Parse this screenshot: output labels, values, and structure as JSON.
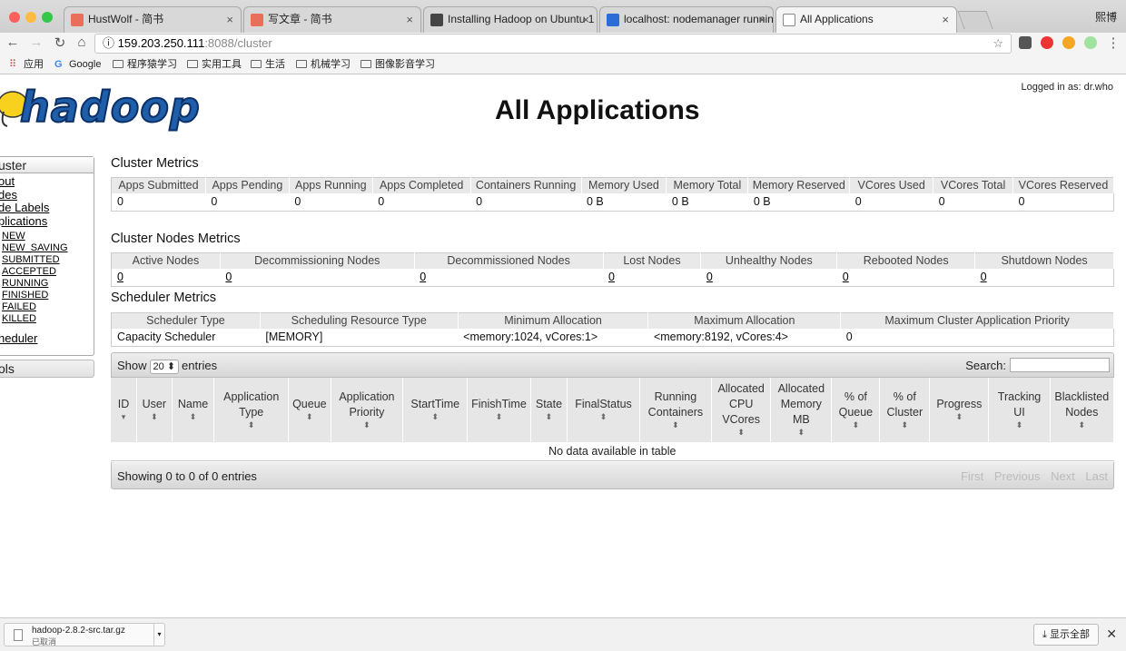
{
  "browser": {
    "tabs": [
      {
        "title": "HustWolf - 简书",
        "favicon_color": "#ea6f5a"
      },
      {
        "title": "写文章 - 简书",
        "favicon_color": "#ea6f5a"
      },
      {
        "title": "Installing Hadoop on Ubuntu 1",
        "favicon_color": "#444444"
      },
      {
        "title": "localhost: nodemanager runnin",
        "favicon_color": "#2d6bd6"
      },
      {
        "title": "All Applications",
        "favicon_color": "#ffffff"
      }
    ],
    "profile_name": "熙博",
    "url_host": "159.203.250.111",
    "url_path": ":8088/cluster",
    "url_info_icon": "ⓘ",
    "bookmarks": [
      "应用",
      "Google",
      "程序猿学习",
      "实用工具",
      "生活",
      "机械学习",
      "图像影音学习"
    ]
  },
  "page": {
    "title": "All Applications",
    "logo_text": "hadoop",
    "logged_in": "Logged in as: dr.who"
  },
  "sidebar": {
    "cluster_label": "uster",
    "links": [
      "out",
      "des",
      "de Labels",
      "plications"
    ],
    "states": [
      "NEW",
      "NEW_SAVING",
      "SUBMITTED",
      "ACCEPTED",
      "RUNNING",
      "FINISHED",
      "FAILED",
      "KILLED"
    ],
    "scheduler": "heduler",
    "tools": "ols"
  },
  "cluster_metrics": {
    "title": "Cluster Metrics",
    "headers": [
      "Apps Submitted",
      "Apps Pending",
      "Apps Running",
      "Apps Completed",
      "Containers Running",
      "Memory Used",
      "Memory Total",
      "Memory Reserved",
      "VCores Used",
      "VCores Total",
      "VCores Reserved"
    ],
    "values": [
      "0",
      "0",
      "0",
      "0",
      "0",
      "0 B",
      "0 B",
      "0 B",
      "0",
      "0",
      "0"
    ]
  },
  "node_metrics": {
    "title": "Cluster Nodes Metrics",
    "headers": [
      "Active Nodes",
      "Decommissioning Nodes",
      "Decommissioned Nodes",
      "Lost Nodes",
      "Unhealthy Nodes",
      "Rebooted Nodes",
      "Shutdown Nodes"
    ],
    "values": [
      "0",
      "0",
      "0",
      "0",
      "0",
      "0",
      "0"
    ]
  },
  "scheduler_metrics": {
    "title": "Scheduler Metrics",
    "headers": [
      "Scheduler Type",
      "Scheduling Resource Type",
      "Minimum Allocation",
      "Maximum Allocation",
      "Maximum Cluster Application Priority"
    ],
    "values": [
      "Capacity Scheduler",
      "[MEMORY]",
      "<memory:1024, vCores:1>",
      "<memory:8192, vCores:4>",
      "0"
    ]
  },
  "apps_table": {
    "show_label": "Show",
    "page_length": "20 ⬍",
    "entries_label": "entries",
    "search_label": "Search:",
    "columns": [
      "ID",
      "User",
      "Name",
      "Application Type",
      "Queue",
      "Application Priority",
      "StartTime",
      "FinishTime",
      "State",
      "FinalStatus",
      "Running Containers",
      "Allocated CPU VCores",
      "Allocated Memory MB",
      "% of Queue",
      "% of Cluster",
      "Progress",
      "Tracking UI",
      "Blacklisted Nodes"
    ],
    "empty_message": "No data available in table",
    "info": "Showing 0 to 0 of 0 entries",
    "pager": [
      "First",
      "Previous",
      "Next",
      "Last"
    ]
  },
  "download_bar": {
    "file_name": "hadoop-2.8.2-src.tar.gz",
    "status": "已取消",
    "show_all": "显示全部",
    "show_all_icon": "⤓"
  }
}
